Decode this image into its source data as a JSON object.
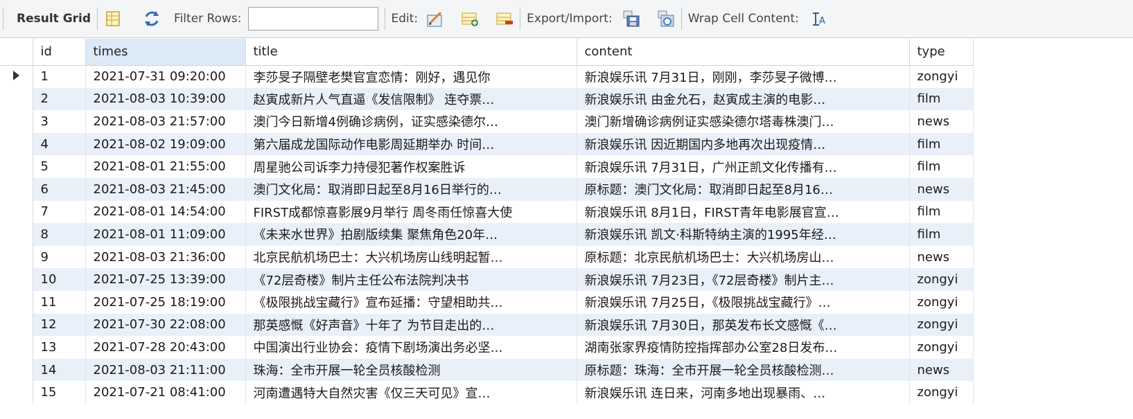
{
  "toolbar": {
    "title": "Result Grid",
    "filter_label": "Filter Rows:",
    "filter_value": "",
    "edit_label": "Edit:",
    "export_label": "Export/Import:",
    "wrap_label": "Wrap Cell Content:",
    "icons": [
      "grid-layout-icon",
      "refresh-icon",
      "edit-cell-icon",
      "insert-row-icon",
      "delete-row-icon",
      "export-icon",
      "import-icon",
      "wrap-text-icon"
    ]
  },
  "columns": [
    "id",
    "times",
    "title",
    "content",
    "type"
  ],
  "selected_column": "times",
  "current_row_index": 0,
  "rows": [
    {
      "id": "1",
      "times": "2021-07-31 09:20:00",
      "title": "李莎旻子隔壁老樊官宣恋情：刚好，遇见你",
      "content": "新浪娱乐讯 7月31日，刚刚，李莎旻子微博…",
      "type": "zongyi"
    },
    {
      "id": "2",
      "times": "2021-08-03 10:39:00",
      "title": "赵寅成新片人气直逼《发信限制》 连夺票…",
      "content": "新浪娱乐讯 由金允石，赵寅成主演的电影…",
      "type": "film"
    },
    {
      "id": "3",
      "times": "2021-08-03 21:57:00",
      "title": "澳门今日新增4例确诊病例，证实感染德尔…",
      "content": "澳门新增确诊病例证实感染德尔塔毒株澳门…",
      "type": "news"
    },
    {
      "id": "4",
      "times": "2021-08-02 19:09:00",
      "title": "第六届成龙国际动作电影周延期举办 时间…",
      "content": "新浪娱乐讯 因近期国内多地再次出现疫情…",
      "type": "film"
    },
    {
      "id": "5",
      "times": "2021-08-01 21:55:00",
      "title": "周星驰公司诉李力持侵犯著作权案胜诉",
      "content": "新浪娱乐讯 7月31日，广州正凯文化传播有…",
      "type": "film"
    },
    {
      "id": "6",
      "times": "2021-08-03 21:45:00",
      "title": "澳门文化局：取消即日起至8月16日举行的…",
      "content": "原标题：澳门文化局：取消即日起至8月16…",
      "type": "news"
    },
    {
      "id": "7",
      "times": "2021-08-01 14:54:00",
      "title": "FIRST成都惊喜影展9月举行 周冬雨任惊喜大使",
      "content": "新浪娱乐讯 8月1日，FIRST青年电影展官宣…",
      "type": "film"
    },
    {
      "id": "8",
      "times": "2021-08-01 11:09:00",
      "title": "《未来水世界》拍剧版续集 聚焦角色20年…",
      "content": "新浪娱乐讯 凯文·科斯特纳主演的1995年经…",
      "type": "film"
    },
    {
      "id": "9",
      "times": "2021-08-03 21:36:00",
      "title": "北京民航机场巴士：大兴机场房山线明起暂…",
      "content": "原标题：北京民航机场巴士：大兴机场房山…",
      "type": "news"
    },
    {
      "id": "10",
      "times": "2021-07-25 13:39:00",
      "title": "《72层奇楼》制片主任公布法院判决书",
      "content": "新浪娱乐讯 7月23日，《72层奇楼》制片主…",
      "type": "zongyi"
    },
    {
      "id": "11",
      "times": "2021-07-25 18:19:00",
      "title": "《极限挑战宝藏行》宣布延播：守望相助共…",
      "content": "新浪娱乐讯 7月25日，《极限挑战宝藏行》…",
      "type": "zongyi"
    },
    {
      "id": "12",
      "times": "2021-07-30 22:08:00",
      "title": "那英感慨《好声音》十年了 为节目走出的…",
      "content": "新浪娱乐讯 7月30日，那英发布长文感慨《…",
      "type": "zongyi"
    },
    {
      "id": "13",
      "times": "2021-07-28 20:43:00",
      "title": "中国演出行业协会：疫情下剧场演出务必坚…",
      "content": "湖南张家界疫情防控指挥部办公室28日发布…",
      "type": "zongyi"
    },
    {
      "id": "14",
      "times": "2021-08-03 21:11:00",
      "title": "珠海：全市开展一轮全员核酸检测",
      "content": "原标题：珠海：全市开展一轮全员核酸检测…",
      "type": "news"
    },
    {
      "id": "15",
      "times": "2021-07-21 08:41:00",
      "title": "河南遭遇特大自然灾害《仅三天可见》宣…",
      "content": "新浪娱乐讯 连日来，河南多地出现暴雨、…",
      "type": "zongyi"
    }
  ]
}
